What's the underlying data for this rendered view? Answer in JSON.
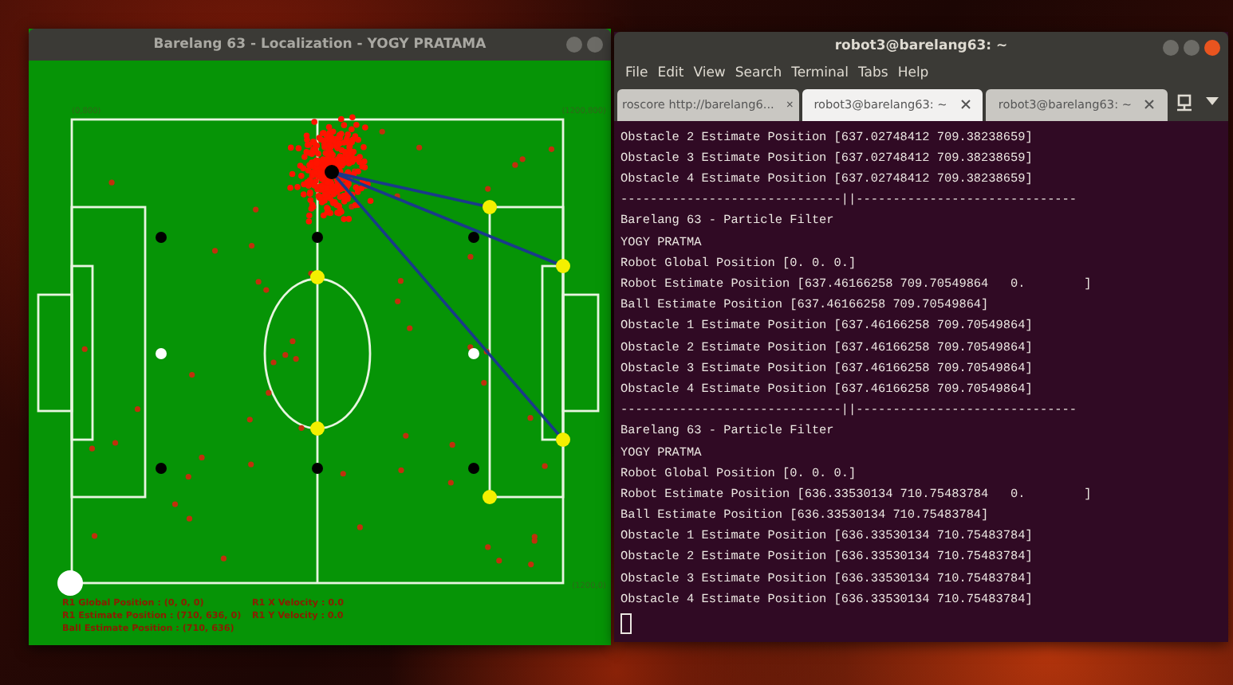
{
  "localization_window": {
    "title": "Barelang 63 - Localization - YOGY PRATAMA",
    "field": {
      "corner_labels": [
        "(0,800)",
        "(1200,800)",
        "(1200,0)"
      ]
    },
    "status_left": [
      "R1 Global Position : (0, 0, 0)",
      "R1 Estimate Position : (710, 636, 0)",
      "Ball Estimate Position : (710, 636)"
    ],
    "status_right": [
      "R1 X Velocity : 0.0",
      "R1 Y Velocity : 0.0"
    ]
  },
  "terminal_window": {
    "title": "robot3@barelang63: ~",
    "menu": [
      "File",
      "Edit",
      "View",
      "Search",
      "Terminal",
      "Tabs",
      "Help"
    ],
    "tabs": [
      {
        "label": "roscore http://barelang6...",
        "selected": false
      },
      {
        "label": "robot3@barelang63: ~",
        "selected": true
      },
      {
        "label": "robot3@barelang63: ~",
        "selected": false
      }
    ],
    "lines": [
      "Obstacle 2 Estimate Position [637.02748412 709.38238659]",
      "Obstacle 3 Estimate Position [637.02748412 709.38238659]",
      "Obstacle 4 Estimate Position [637.02748412 709.38238659]",
      "------------------------------||------------------------------",
      "Barelang 63 - Particle Filter",
      "YOGY PRATMA",
      "Robot Global Position [0. 0. 0.]",
      "Robot Estimate Position [637.46166258 709.70549864   0.        ]",
      "Ball Estimate Position [637.46166258 709.70549864]",
      "Obstacle 1 Estimate Position [637.46166258 709.70549864]",
      "Obstacle 2 Estimate Position [637.46166258 709.70549864]",
      "Obstacle 3 Estimate Position [637.46166258 709.70549864]",
      "Obstacle 4 Estimate Position [637.46166258 709.70549864]",
      "------------------------------||------------------------------",
      "Barelang 63 - Particle Filter",
      "YOGY PRATMA",
      "Robot Global Position [0. 0. 0.]",
      "Robot Estimate Position [636.33530134 710.75483784   0.        ]",
      "Ball Estimate Position [636.33530134 710.75483784]",
      "Obstacle 1 Estimate Position [636.33530134 710.75483784]",
      "Obstacle 2 Estimate Position [636.33530134 710.75483784]",
      "Obstacle 3 Estimate Position [636.33530134 710.75483784]",
      "Obstacle 4 Estimate Position [636.33530134 710.75483784]"
    ]
  }
}
